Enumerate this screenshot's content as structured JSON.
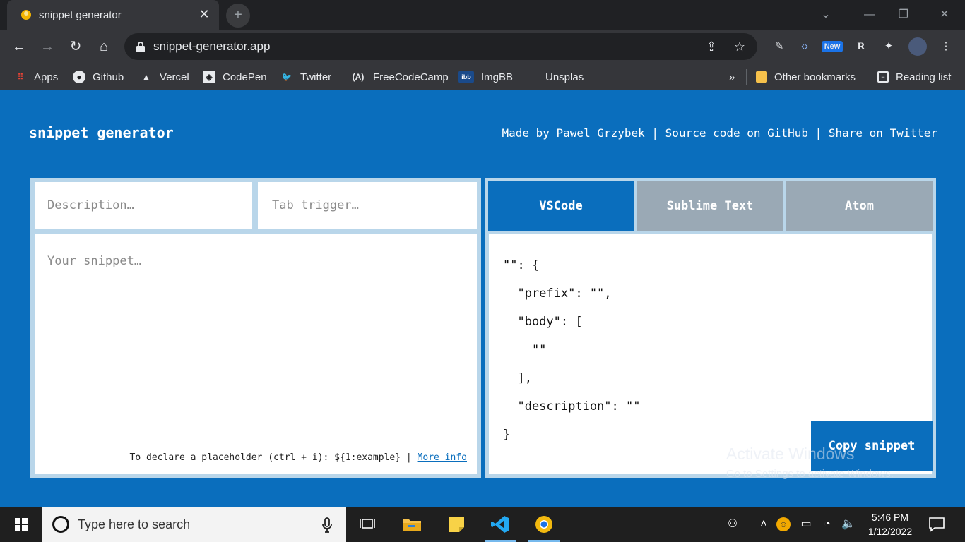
{
  "browser": {
    "tab_title": "snippet generator",
    "tab_close": "✕",
    "new_tab": "+",
    "url": "snippet-generator.app",
    "bookmarks": [
      "Apps",
      "Github",
      "Vercel",
      "CodePen",
      "Twitter",
      "FreeCodeCamp",
      "ImgBB",
      "Unsplas"
    ],
    "overflow": "»",
    "other_bookmarks": "Other bookmarks",
    "reading_list": "Reading list",
    "ext_badge_new": "New",
    "ext_r": "R"
  },
  "header": {
    "title": "snippet generator",
    "made_by": "Made by ",
    "author": "Pawel Grzybek",
    "sep": " | ",
    "source_prefix": "Source code on ",
    "github": "GitHub",
    "share": "Share on Twitter"
  },
  "form": {
    "description_placeholder": "Description…",
    "trigger_placeholder": "Tab trigger…",
    "snippet_placeholder": "Your snippet…",
    "hint_text": "To declare a placeholder (ctrl + i): ${1:example} | ",
    "hint_link": "More info"
  },
  "output": {
    "tabs": [
      "VSCode",
      "Sublime Text",
      "Atom"
    ],
    "active_tab": "VSCode",
    "code": "\"\": {\n  \"prefix\": \"\",\n  \"body\": [\n    \"\"\n  ],\n  \"description\": \"\"\n}",
    "copy_label": "Copy snippet"
  },
  "watermark": {
    "line1": "Activate Windows",
    "line2": "Go to Settings to activate Windows."
  },
  "taskbar": {
    "search_placeholder": "Type here to search",
    "time": "5:46 PM",
    "date": "1/12/2022"
  },
  "colors": {
    "brand_blue": "#0a6ebd",
    "tab_inactive": "#9aa9b5",
    "panel_border": "#b9d6ea"
  }
}
